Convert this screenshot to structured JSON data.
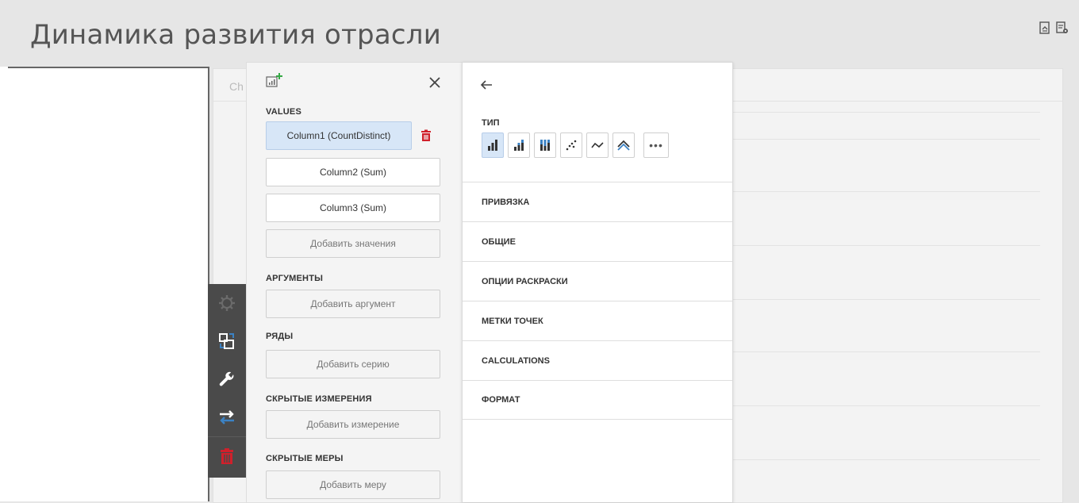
{
  "dashboard": {
    "title": "Динамика развития отрасли"
  },
  "chart_item": {
    "caption": "Ch"
  },
  "binding_panel": {
    "sections": {
      "values": "VALUES",
      "arguments": "АРГУМЕНТЫ",
      "series": "РЯДЫ",
      "hidden_dimensions": "СКРЫТЫЕ ИЗМЕРЕНИЯ",
      "hidden_measures": "СКРЫТЫЕ МЕРЫ"
    },
    "values": [
      {
        "label": "Column1 (CountDistinct)",
        "selected": true
      },
      {
        "label": "Column2 (Sum)",
        "selected": false
      },
      {
        "label": "Column3 (Sum)",
        "selected": false
      }
    ],
    "placeholders": {
      "add_value": "Добавить значения",
      "add_argument": "Добавить аргумент",
      "add_series": "Добавить серию",
      "add_dimension": "Добавить измерение",
      "add_measure": "Добавить меру"
    }
  },
  "options_panel": {
    "type_label": "ТИП",
    "chart_types": [
      "bar-icon",
      "stacked-bar-icon",
      "full-stacked-bar-icon",
      "point-icon",
      "line-icon",
      "area-icon"
    ],
    "more_label": "•••",
    "sections": [
      "ПРИВЯЗКА",
      "ОБЩИЕ",
      "ОПЦИИ РАСКРАСКИ",
      "МЕТКИ ТОЧЕК",
      "CALCULATIONS",
      "ФОРМАТ"
    ]
  },
  "colors": {
    "accent_blue": "#3b82c4",
    "selection": "#d7e6f7",
    "delete_red": "#d0202b",
    "toolbar_bg": "#4a4a4a",
    "add_green": "#35a845"
  }
}
